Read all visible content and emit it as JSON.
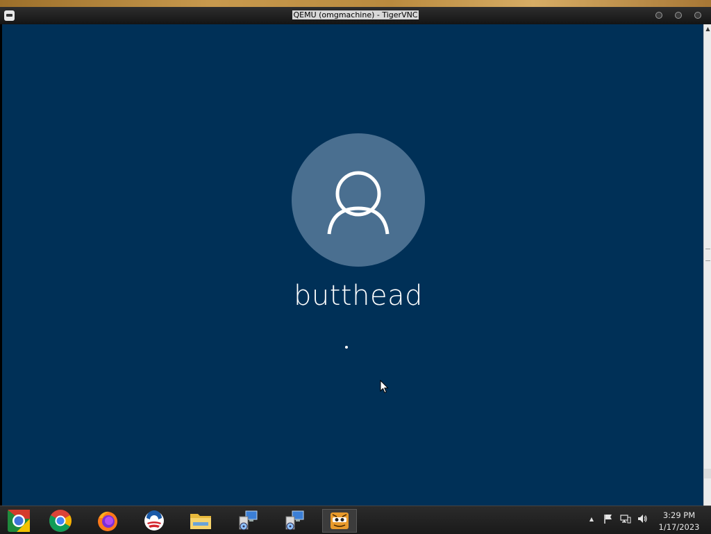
{
  "window": {
    "title": "QEMU (omgmachine) - TigerVNC"
  },
  "lock_screen": {
    "username": "butthead",
    "background_color": "#003057",
    "avatar_color": "#4a6f90"
  },
  "taskbar": {
    "apps": [
      {
        "name": "chromium-icon"
      },
      {
        "name": "chrome-icon"
      },
      {
        "name": "firefox-icon"
      },
      {
        "name": "obama-logo-icon"
      },
      {
        "name": "file-manager-icon"
      },
      {
        "name": "network-setup-icon"
      },
      {
        "name": "network-setup-icon-2"
      },
      {
        "name": "tigervnc-icon"
      }
    ],
    "tray": {
      "show_hidden_label": "▲",
      "time": "3:29 PM",
      "date": "1/17/2023"
    }
  }
}
